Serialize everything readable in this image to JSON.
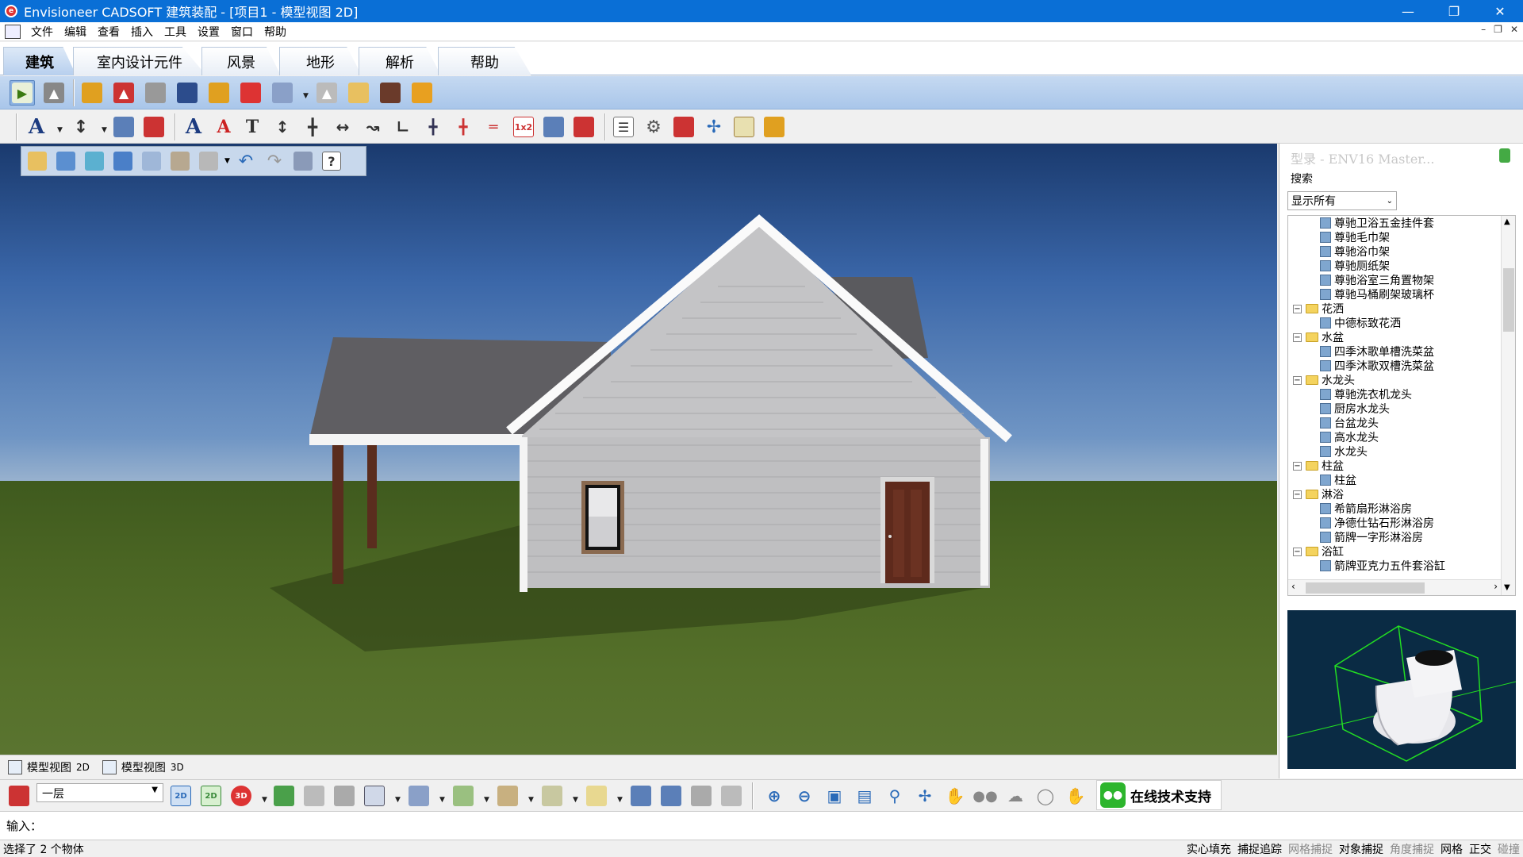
{
  "window": {
    "title": "Envisioneer CADSOFT 建筑装配 - [项目1 - 模型视图 2D]"
  },
  "menu": [
    "文件",
    "编辑",
    "查看",
    "插入",
    "工具",
    "设置",
    "窗口",
    "帮助"
  ],
  "ribbon_tabs": [
    "建筑",
    "室内设计元件",
    "风景",
    "地形",
    "解析",
    "帮助"
  ],
  "active_tab": "建筑",
  "view_tabs": [
    {
      "label": "模型视图",
      "suffix": "2D"
    },
    {
      "label": "模型视图",
      "suffix": "3D"
    }
  ],
  "catalog": {
    "title": "型录 - ENV16 Master...",
    "search_label": "搜索",
    "filter": "显示所有",
    "tree": [
      {
        "type": "leaf",
        "text": "尊驰卫浴五金挂件套"
      },
      {
        "type": "leaf",
        "text": "尊驰毛巾架"
      },
      {
        "type": "leaf",
        "text": "尊驰浴巾架"
      },
      {
        "type": "leaf",
        "text": "尊驰厕纸架"
      },
      {
        "type": "leaf",
        "text": "尊驰浴室三角置物架"
      },
      {
        "type": "leaf",
        "text": "尊驰马桶刷架玻璃杯"
      },
      {
        "type": "folder",
        "text": "花洒"
      },
      {
        "type": "leaf",
        "text": "中德标致花洒"
      },
      {
        "type": "folder",
        "text": "水盆"
      },
      {
        "type": "leaf",
        "text": "四季沐歌单槽洗菜盆"
      },
      {
        "type": "leaf",
        "text": "四季沐歌双槽洗菜盆"
      },
      {
        "type": "folder",
        "text": "水龙头"
      },
      {
        "type": "leaf",
        "text": "尊驰洗衣机龙头"
      },
      {
        "type": "leaf",
        "text": "厨房水龙头"
      },
      {
        "type": "leaf",
        "text": "台盆龙头"
      },
      {
        "type": "leaf",
        "text": "高水龙头"
      },
      {
        "type": "leaf",
        "text": "水龙头"
      },
      {
        "type": "folder",
        "text": "柱盆"
      },
      {
        "type": "leaf",
        "text": "柱盆"
      },
      {
        "type": "folder",
        "text": "淋浴"
      },
      {
        "type": "leaf",
        "text": "希箭扇形淋浴房"
      },
      {
        "type": "leaf",
        "text": "净德仕钻石形淋浴房"
      },
      {
        "type": "leaf",
        "text": "箭牌一字形淋浴房"
      },
      {
        "type": "folder",
        "text": "浴缸"
      },
      {
        "type": "leaf",
        "text": "箭牌亚克力五件套浴缸"
      }
    ]
  },
  "floor_selector": {
    "value": "一层"
  },
  "support": {
    "label": "在线技术支持"
  },
  "command": {
    "label": "输入："
  },
  "status": {
    "message": "选择了 2 个物体",
    "toggles": [
      {
        "label": "实心填充",
        "on": true
      },
      {
        "label": "捕捉追踪",
        "on": true
      },
      {
        "label": "网格捕捉",
        "on": false
      },
      {
        "label": "对象捕捉",
        "on": true
      },
      {
        "label": "角度捕捉",
        "on": false
      },
      {
        "label": "网格",
        "on": true
      },
      {
        "label": "正交",
        "on": true
      },
      {
        "label": "碰撞",
        "on": false
      }
    ]
  },
  "colors": {
    "titlebar": "#0a6fd6",
    "ribbon": "#b7cfee",
    "sky": "#3a66a8",
    "grass": "#4a6523"
  }
}
